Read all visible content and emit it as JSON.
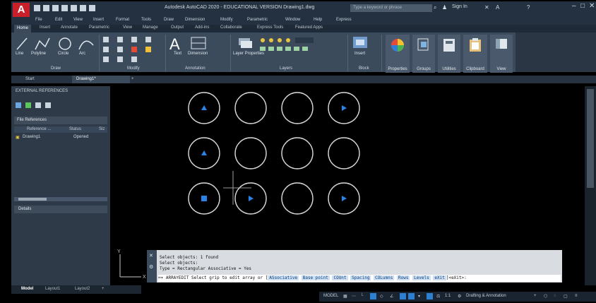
{
  "app": {
    "logo_letter": "A",
    "window_title": "Autodesk AutoCAD 2020 - EDUCATIONAL VERSION  Drawing1.dwg",
    "search_placeholder": "Type a keyword or phrase",
    "signin_label": "Sign In"
  },
  "menubar": [
    "File",
    "Edit",
    "View",
    "Insert",
    "Format",
    "Tools",
    "Draw",
    "Dimension",
    "Modify",
    "Parametric",
    "Window",
    "Help",
    "Express"
  ],
  "ribbon_tabs": [
    "Home",
    "Insert",
    "Annotate",
    "Parametric",
    "View",
    "Manage",
    "Output",
    "Add-ins",
    "Collaborate",
    "Express Tools",
    "Featured Apps"
  ],
  "ribbon": {
    "draw_tools": [
      "Line",
      "Polyline",
      "Circle",
      "Arc"
    ],
    "text_label": "Text",
    "dimension_label": "Dimension",
    "layer_props_label": "Layer Properties",
    "insert_label": "Insert",
    "properties_label": "Properties",
    "groups_label": "Groups",
    "utilities_label": "Utilities",
    "clipboard_label": "Clipboard",
    "view_label": "View",
    "panel_titles": [
      "Draw",
      "Modify",
      "Annotation",
      "Layers",
      "Block"
    ]
  },
  "doc_tabs": [
    "Start",
    "Drawing1*"
  ],
  "palette": {
    "title": "EXTERNAL REFERENCES",
    "file_refs_header": "File References",
    "columns": [
      "Reference ...",
      "Status",
      "Siz"
    ],
    "rows": [
      {
        "name": "Drawing1",
        "status": "Opened"
      }
    ],
    "details_header": "Details"
  },
  "canvas": {
    "ucs_y_label": "Y",
    "ucs_x_label": "X",
    "grid_rows": 3,
    "grid_cols": 4,
    "circle_color": "#d7d7d7",
    "grip_color": "#2a83e6"
  },
  "command": {
    "history": [
      "Select objects: 1 found",
      "Select objects:",
      "Type = Rectangular  Associative = Yes"
    ],
    "prompt": "ARRAYEDIT Select grip to edit array or [",
    "options": [
      "ASsociative",
      "Base point",
      "COUnt",
      "Spacing",
      "COLumns",
      "Rows",
      "Levels",
      "eXit"
    ],
    "suffix": "]<eXit>:"
  },
  "model_tabs": [
    "Model",
    "Layout1",
    "Layout2",
    "+"
  ],
  "status": {
    "model_label": "MODEL",
    "scale_label": "1:1",
    "workspace_label": "Drafting & Annotation"
  }
}
